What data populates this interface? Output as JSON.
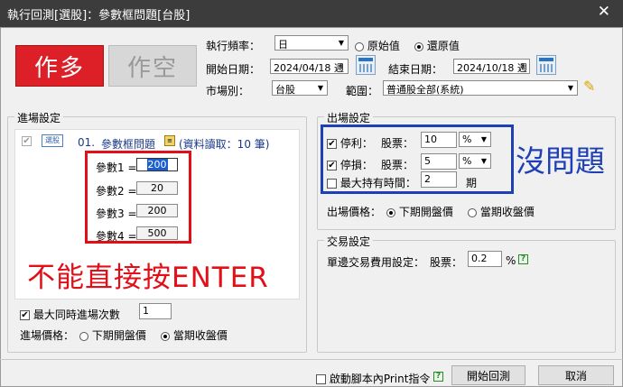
{
  "window": {
    "title": "執行回測[選股]：參數框問題[台股]",
    "close_glyph": "✕"
  },
  "top": {
    "btn_long": "作多",
    "btn_short": "作空",
    "freq_label": "執行頻率：",
    "freq_value": "日",
    "radio_orig": "原始值",
    "radio_restore": "還原值",
    "start_label": "開始日期：",
    "start_value": "2024/04/18 週",
    "end_label": "結束日期：",
    "end_value": "2024/10/18 週",
    "market_label": "市場別：",
    "market_value": "台股",
    "range_label": "範圍：",
    "range_value": "普通股全部(系統)"
  },
  "entry": {
    "title": "進場設定",
    "script_badge": "選股",
    "script_num": "01.",
    "script_name": "參數框問題",
    "script_info": "(資料讀取：10 筆)",
    "params": [
      {
        "label": "參數1 =",
        "value": "200"
      },
      {
        "label": "參數2 =",
        "value": "20"
      },
      {
        "label": "參數3 =",
        "value": "200"
      },
      {
        "label": "參數4 =",
        "value": "500"
      }
    ],
    "annotation": "不能直接按ENTER",
    "max_label": "最大同時進場次數",
    "max_value": "1",
    "price_label": "進場價格：",
    "price_opt1": "下期開盤價",
    "price_opt2": "當期收盤價"
  },
  "exit": {
    "title": "出場設定",
    "stop_profit_label": "停利：",
    "stop_loss_label": "停損：",
    "stock_label": "股票：",
    "stop_profit_value": "10",
    "stop_loss_value": "5",
    "unit": "%",
    "max_hold_label": "最大持有時間：",
    "max_hold_value": "2",
    "period": "期",
    "annotation": "沒問題",
    "price_label": "出場價格：",
    "price_opt1": "下期開盤價",
    "price_opt2": "當期收盤價"
  },
  "fee": {
    "title": "交易設定",
    "label": "單邊交易費用設定：",
    "stock_label": "股票：",
    "value": "0.2",
    "unit": "%",
    "help": "?"
  },
  "bottom": {
    "print_label": "啟動腳本內Print指令",
    "help": "?",
    "start_btn": "開始回測",
    "cancel_btn": "取消"
  }
}
